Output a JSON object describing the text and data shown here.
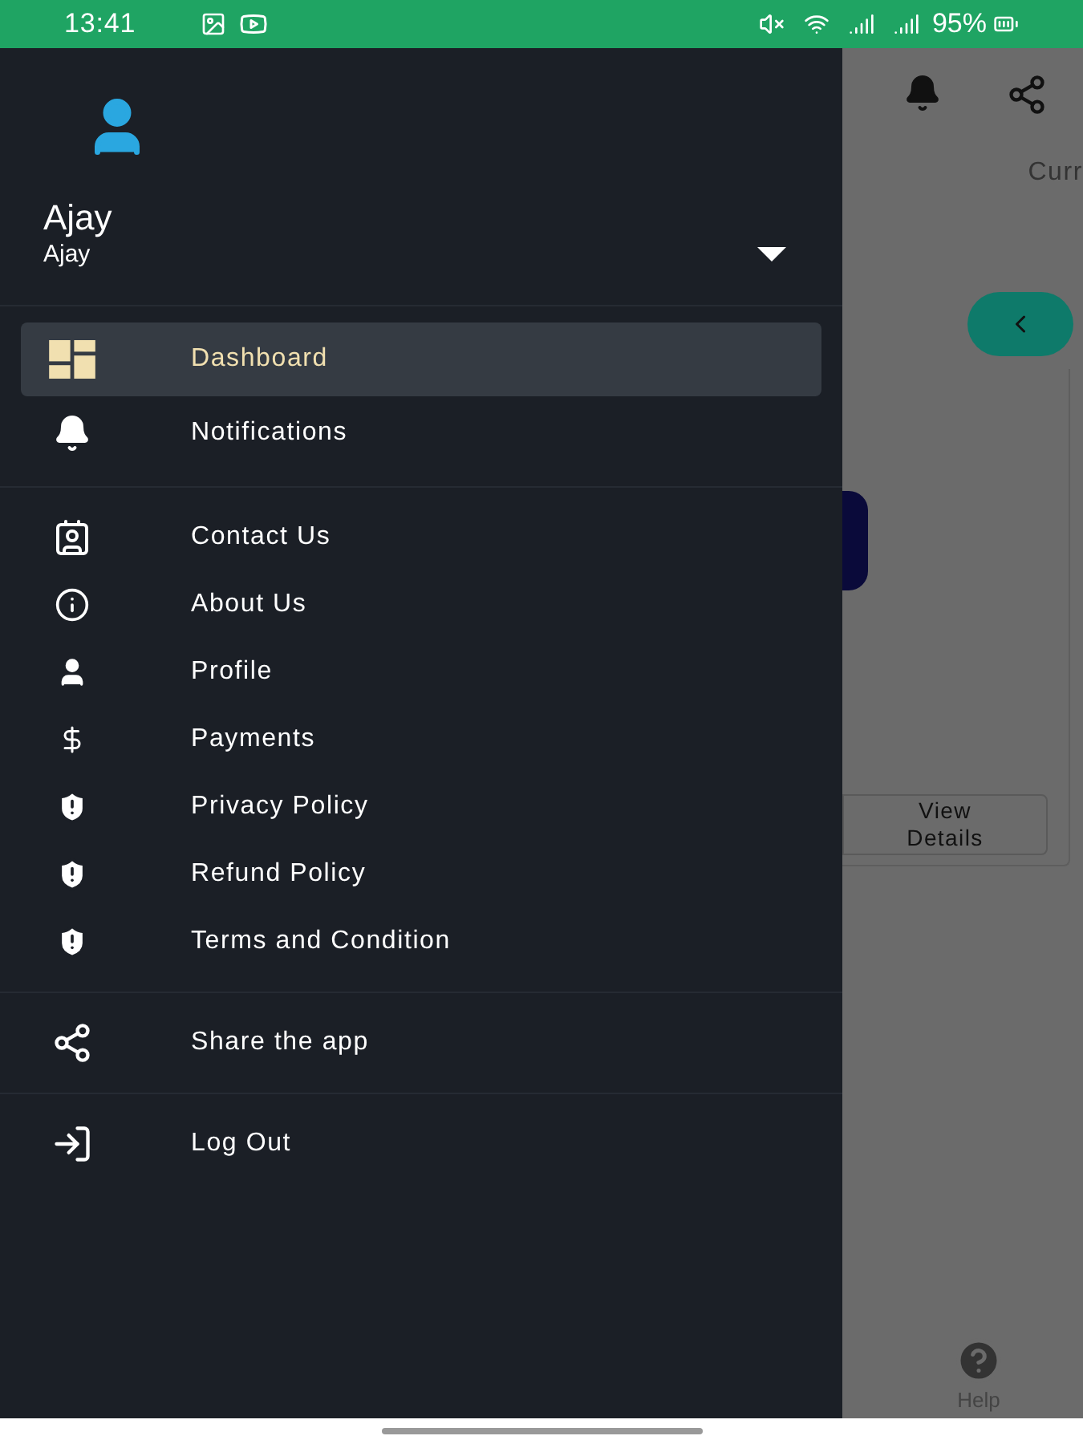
{
  "status_bar": {
    "time": "13:41",
    "battery": "95%"
  },
  "drawer": {
    "user": {
      "name": "Ajay",
      "subtitle": "Ajay",
      "expanded": false
    },
    "groups": [
      [
        {
          "kind": "dashboard",
          "label": "Dashboard",
          "selected": true
        },
        {
          "kind": "bell",
          "label": "Notifications",
          "selected": false
        }
      ],
      [
        {
          "kind": "contact",
          "label": "Contact Us",
          "selected": false
        },
        {
          "kind": "info",
          "label": "About Us",
          "selected": false
        },
        {
          "kind": "person",
          "label": "Profile",
          "selected": false
        },
        {
          "kind": "dollar",
          "label": "Payments",
          "selected": false
        },
        {
          "kind": "shield",
          "label": "Privacy Policy",
          "selected": false
        },
        {
          "kind": "shield",
          "label": "Refund Policy",
          "selected": false
        },
        {
          "kind": "shield",
          "label": "Terms and Condition",
          "selected": false
        }
      ],
      [
        {
          "kind": "share",
          "label": "Share the app",
          "selected": false
        }
      ],
      [
        {
          "kind": "logout",
          "label": "Log Out",
          "selected": false
        }
      ]
    ]
  },
  "background": {
    "tab": "Curr",
    "button": "View Details",
    "help": "Help"
  }
}
